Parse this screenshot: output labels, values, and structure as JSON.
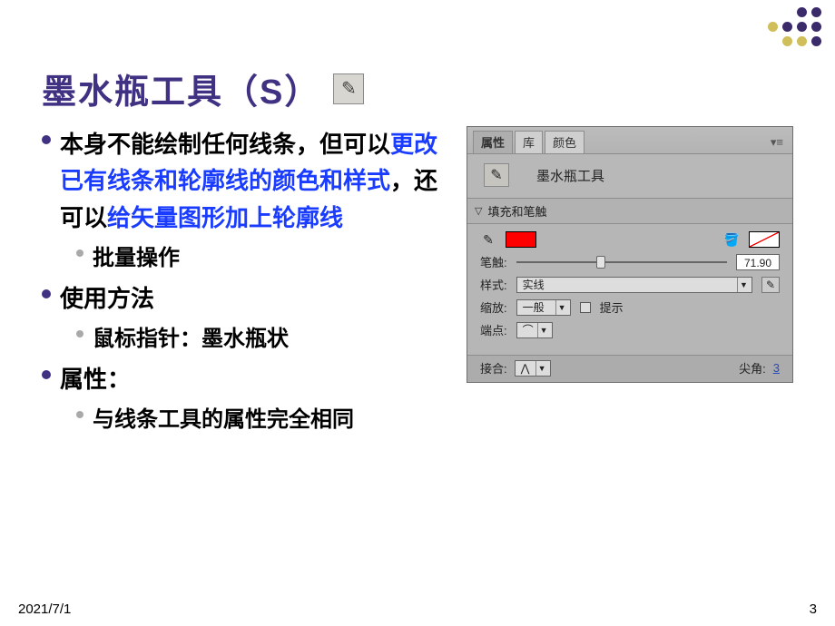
{
  "title": "墨水瓶工具（S）",
  "bullets": {
    "p1_a": "本身不能绘制任何线条，但可以",
    "p1_b": "更改已有线条和轮廓线的颜色和样式",
    "p1_c": "，还可以",
    "p1_d": "给矢量图形加上轮廓线",
    "p1_sub1": "批量操作",
    "p2": "使用方法",
    "p2_sub1": "鼠标指针：墨水瓶状",
    "p3": "属性：",
    "p3_sub1": "与线条工具的属性完全相同"
  },
  "panel": {
    "tabs": {
      "props": "属性",
      "lib": "库",
      "color": "颜色"
    },
    "tool_label": "墨水瓶工具",
    "section": "填充和笔触",
    "stroke_color": "#ff0000",
    "fill": "none",
    "stroke_label": "笔触:",
    "stroke_value": "71.90",
    "style_label": "样式:",
    "style_value": "实线",
    "scale_label": "缩放:",
    "scale_value": "一般",
    "hint_label": "提示",
    "cap_label": "端点:",
    "join_label": "接合:",
    "miter_label": "尖角:",
    "miter_value": "3"
  },
  "footer": {
    "date": "2021/7/1",
    "page": "3"
  }
}
